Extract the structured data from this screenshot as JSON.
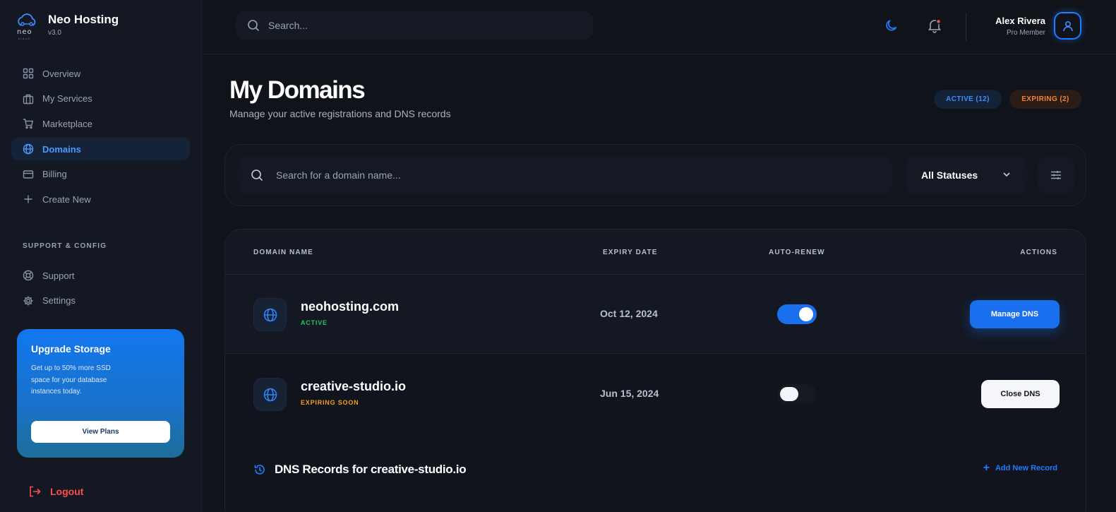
{
  "brand": {
    "name": "Neo Hosting",
    "version": "v3.0",
    "logo_word": "neo",
    "logo_sub": "cloud"
  },
  "sidebar": {
    "items": [
      {
        "label": "Overview",
        "icon": "grid-icon"
      },
      {
        "label": "My Services",
        "icon": "briefcase-icon"
      },
      {
        "label": "Marketplace",
        "icon": "cart-icon"
      },
      {
        "label": "Domains",
        "icon": "globe-icon",
        "active": true
      },
      {
        "label": "Billing",
        "icon": "card-icon"
      },
      {
        "label": "Create New",
        "icon": "plus-icon"
      }
    ],
    "section_label": "SUPPORT & CONFIG",
    "support_items": [
      {
        "label": "Support",
        "icon": "lifebuoy-icon"
      },
      {
        "label": "Settings",
        "icon": "gear-icon"
      }
    ],
    "upgrade": {
      "title": "Upgrade Storage",
      "text": "Get up to 50% more SSD space for your database instances today.",
      "button": "View Plans"
    },
    "logout": "Logout"
  },
  "topbar": {
    "search_placeholder": "Search...",
    "user_name": "Alex Rivera",
    "user_role": "Pro Member"
  },
  "header": {
    "title": "My Domains",
    "subtitle": "Manage your active registrations and DNS records",
    "badge_active": "ACTIVE (12)",
    "badge_expiring": "EXPIRING (2)"
  },
  "filters": {
    "search_placeholder": "Search for a domain name...",
    "status_value": "All Statuses"
  },
  "table": {
    "columns": [
      "DOMAIN NAME",
      "EXPIRY DATE",
      "AUTO-RENEW",
      "ACTIONS"
    ],
    "rows": [
      {
        "domain": "neohosting.com",
        "status": "ACTIVE",
        "expiry": "Oct 12, 2024",
        "auto_renew": true,
        "action": "Manage DNS"
      },
      {
        "domain": "creative-studio.io",
        "status": "EXPIRING SOON",
        "expiry": "Jun 15, 2024",
        "auto_renew": false,
        "action": "Close DNS"
      }
    ]
  },
  "dns": {
    "title": "DNS Records for creative-studio.io",
    "add_label": "Add New Record"
  },
  "colors": {
    "accent": "#1a6fef",
    "active_green": "#21c45d",
    "warning_orange": "#f59f1b",
    "danger_red": "#ff4d4d",
    "background": "#10131a"
  }
}
